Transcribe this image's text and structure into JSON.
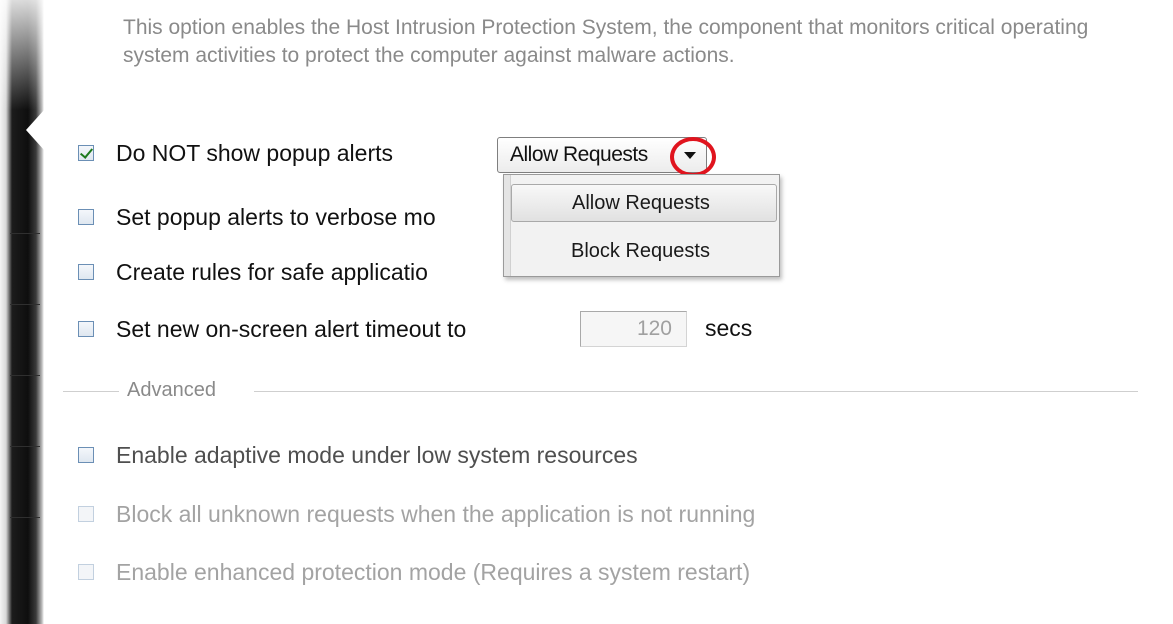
{
  "description": "This option enables the Host Intrusion Protection System, the component that monitors critical operating system activities to protect the computer against malware actions.",
  "options": {
    "no_popup": {
      "label": "Do NOT show popup alerts",
      "checked": true
    },
    "verbose": {
      "label": "Set popup alerts to verbose mo",
      "checked": false
    },
    "safe_rules": {
      "label": "Create rules for safe applicatio",
      "checked": false
    },
    "timeout": {
      "label": "Set new on-screen alert timeout to",
      "checked": false,
      "value": "120",
      "unit": "secs"
    }
  },
  "popup_action": {
    "selected": "Allow Requests",
    "menu": [
      "Allow Requests",
      "Block Requests"
    ],
    "highlighted": "Allow Requests"
  },
  "advanced": {
    "title": "Advanced",
    "adaptive_mode": {
      "label": "Enable adaptive mode under low system resources",
      "checked": false
    },
    "block_unknown": {
      "label": "Block all unknown requests when the application is not running",
      "checked": false,
      "disabled": true
    },
    "enhanced_protection": {
      "label": "Enable enhanced protection mode (Requires a system restart)",
      "checked": false,
      "disabled": true
    }
  },
  "colors": {
    "annotation_circle": "#e0141e",
    "checkmark": "#1e7a1e"
  }
}
